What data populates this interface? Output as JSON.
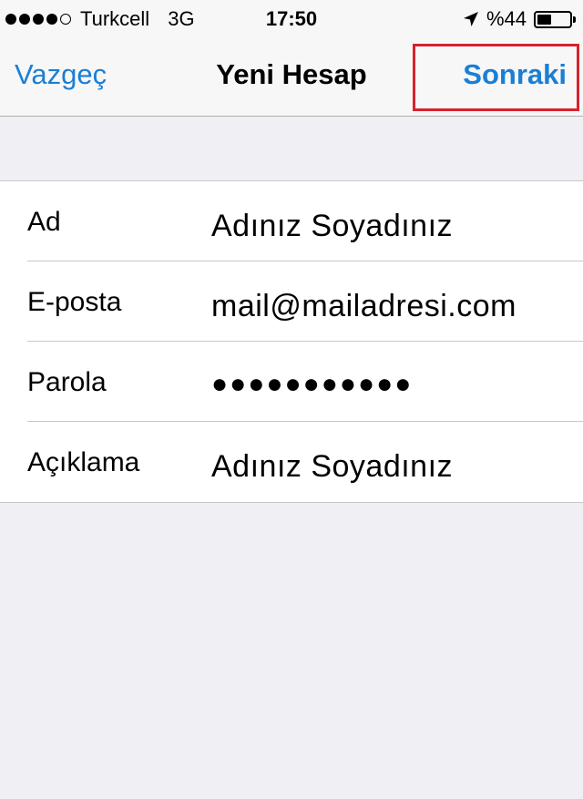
{
  "status_bar": {
    "signal_filled": 4,
    "signal_total": 5,
    "carrier": "Turkcell",
    "network": "3G",
    "time": "17:50",
    "location_icon": "location-arrow-icon",
    "battery_text": "%44",
    "battery_level": 0.44
  },
  "nav": {
    "cancel_label": "Vazgeç",
    "title": "Yeni Hesap",
    "next_label": "Sonraki",
    "highlight_color": "#d6232e",
    "accent_color": "#1a7fd4"
  },
  "form": {
    "rows": [
      {
        "label": "Ad",
        "value": "Adınız Soyadınız"
      },
      {
        "label": "E-posta",
        "value": "mail@mailadresi.com"
      },
      {
        "label": "Parola",
        "value": "●●●●●●●●●●●"
      },
      {
        "label": "Açıklama",
        "value": "Adınız Soyadınız"
      }
    ]
  }
}
